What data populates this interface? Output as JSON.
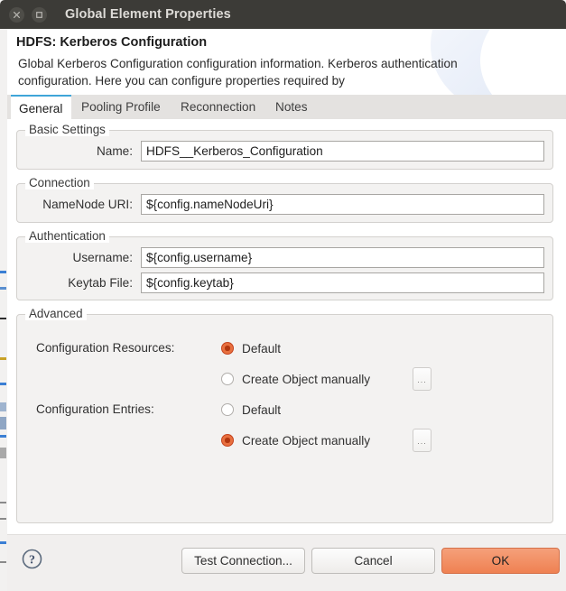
{
  "window": {
    "title": "Global Element Properties",
    "close_icon": "close-icon",
    "maximize_icon": "maximize-icon"
  },
  "header": {
    "title": "HDFS: Kerberos Configuration",
    "description": "Global Kerberos Configuration configuration information. Kerberos authentication configuration. Here you can configure properties required by"
  },
  "tabs": [
    {
      "label": "General",
      "active": true
    },
    {
      "label": "Pooling Profile",
      "active": false
    },
    {
      "label": "Reconnection",
      "active": false
    },
    {
      "label": "Notes",
      "active": false
    }
  ],
  "groups": {
    "basic_settings": {
      "title": "Basic Settings",
      "fields": [
        {
          "label": "Name:",
          "value": "HDFS__Kerberos_Configuration",
          "placeholder": ""
        }
      ]
    },
    "connection": {
      "title": "Connection",
      "fields": [
        {
          "label": "NameNode URI:",
          "value": "${config.nameNodeUri}",
          "placeholder": ""
        }
      ]
    },
    "authentication": {
      "title": "Authentication",
      "fields": [
        {
          "label": "Username:",
          "value": "${config.username}",
          "placeholder": ""
        },
        {
          "label": "Keytab File:",
          "value": "${config.keytab}",
          "placeholder": ""
        }
      ]
    },
    "advanced": {
      "title": "Advanced",
      "rows": [
        {
          "label": "Configuration Resources:",
          "options": [
            {
              "label": "Default",
              "selected": true,
              "has_browse": false
            },
            {
              "label": "Create Object manually",
              "selected": false,
              "has_browse": true,
              "browse_label": "..."
            }
          ]
        },
        {
          "label": "Configuration Entries:",
          "options": [
            {
              "label": "Default",
              "selected": false,
              "has_browse": false
            },
            {
              "label": "Create Object manually",
              "selected": true,
              "has_browse": true,
              "browse_label": "..."
            }
          ]
        }
      ]
    }
  },
  "footer": {
    "help_icon": "help-icon",
    "test_connection_label": "Test Connection...",
    "cancel_label": "Cancel",
    "ok_label": "OK"
  },
  "colors": {
    "titlebar": "#3c3b37",
    "accent_tab": "#3fa5d8",
    "radio_selected": "#e8703f",
    "ok_button": "#ef8152",
    "panel": "#f3f2f1"
  }
}
